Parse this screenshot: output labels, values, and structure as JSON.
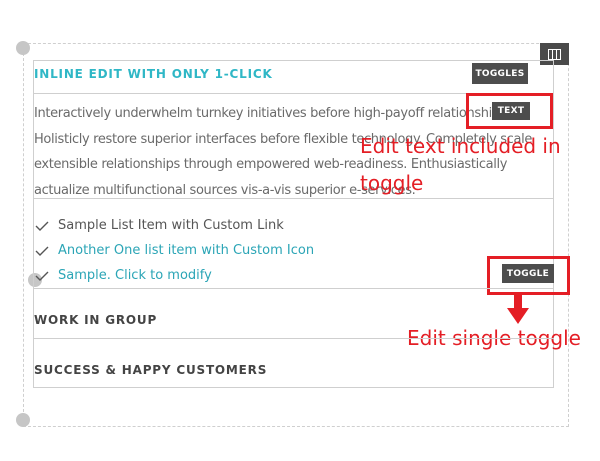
{
  "accordion": {
    "title": "INLINE EDIT WITH ONLY 1-CLICK",
    "paragraph": "Interactively underwhelm turnkey initiatives before high-payoff relationships. Holisticly restore superior interfaces before flexible technology. Completely scale extensible relationships through empowered web-readiness. Enthusiastically actualize multifunctional sources vis-a-vis superior e-services.",
    "list_items": [
      {
        "label": "Sample List Item with Custom Link",
        "icon": "check-icon"
      },
      {
        "label": "Another One list item with Custom Icon",
        "icon": "check-icon"
      },
      {
        "label": "Sample. Click to modify",
        "icon": "check-icon"
      }
    ],
    "groups": [
      "WORK IN GROUP",
      "SUCCESS & HAPPY CUSTOMERS"
    ]
  },
  "tags": {
    "toggles": "TOGGLES",
    "text": "TEXT",
    "toggle": "TOGGLE"
  },
  "annotations": {
    "edit_text_line1": "Edit text included in",
    "edit_text_line2": "toggle",
    "edit_single": "Edit single toggle"
  },
  "colors": {
    "accent": "#2fb7c6",
    "link": "#2ba5b6",
    "annotation": "#e41e25",
    "tag_bg": "#4d4d4d"
  },
  "icons": {
    "layout": "columns-icon",
    "arrow": "arrow-down-icon"
  }
}
